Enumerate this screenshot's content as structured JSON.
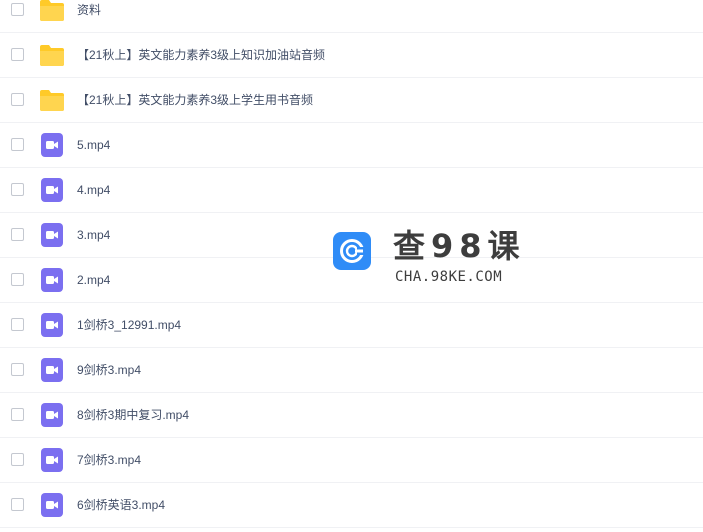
{
  "files": [
    {
      "name": "资料",
      "type": "folder"
    },
    {
      "name": "【21秋上】英文能力素养3级上知识加油站音频",
      "type": "folder"
    },
    {
      "name": "【21秋上】英文能力素养3级上学生用书音频",
      "type": "folder"
    },
    {
      "name": "5.mp4",
      "type": "video"
    },
    {
      "name": "4.mp4",
      "type": "video"
    },
    {
      "name": "3.mp4",
      "type": "video"
    },
    {
      "name": "2.mp4",
      "type": "video"
    },
    {
      "name": "1剑桥3_12991.mp4",
      "type": "video"
    },
    {
      "name": "9剑桥3.mp4",
      "type": "video"
    },
    {
      "name": "8剑桥3期中复习.mp4",
      "type": "video"
    },
    {
      "name": "7剑桥3.mp4",
      "type": "video"
    },
    {
      "name": "6剑桥英语3.mp4",
      "type": "video"
    }
  ],
  "watermark": {
    "title": "查98课",
    "subtitle": "CHA.98KE.COM"
  },
  "colors": {
    "folder": "#ffca28",
    "video": "#7b6ff0",
    "logo": "#2f8cf7"
  }
}
